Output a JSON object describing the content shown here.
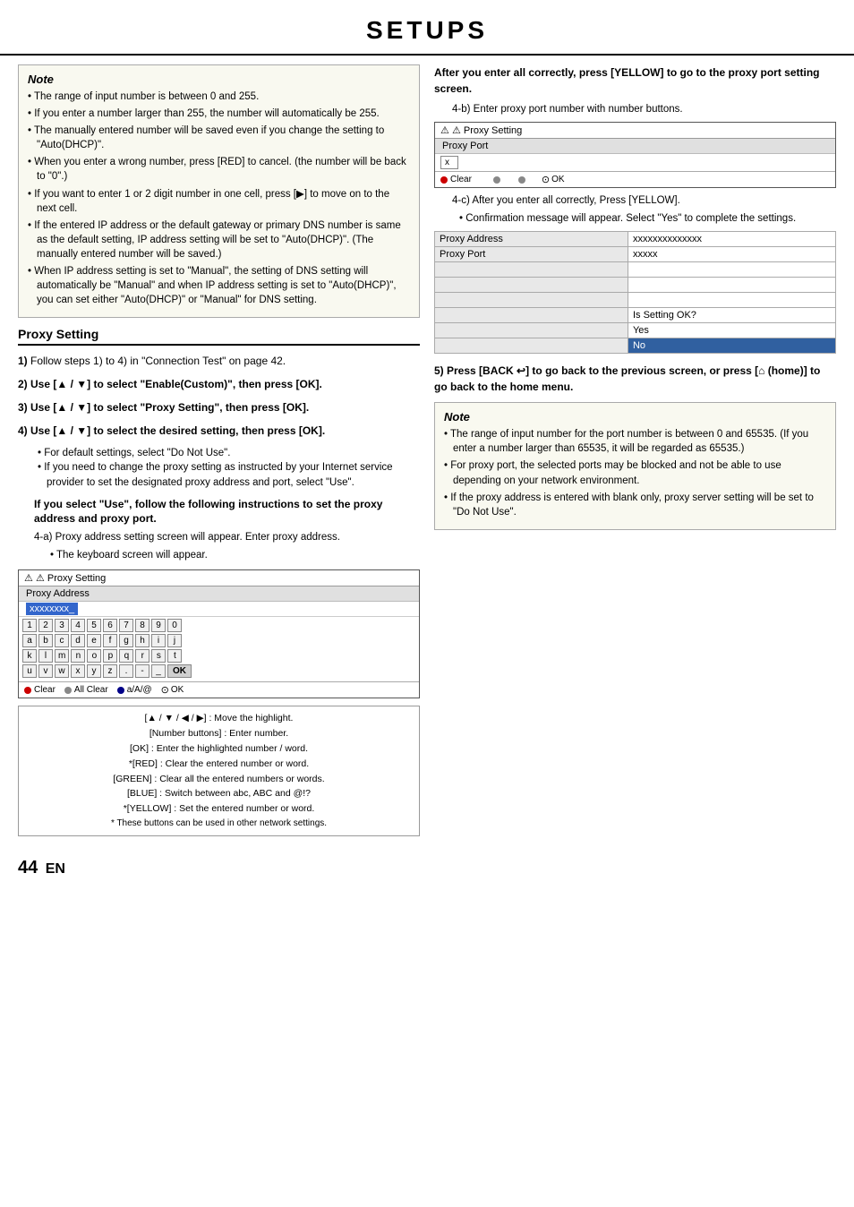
{
  "header": {
    "title": "SETUPS"
  },
  "left": {
    "note": {
      "title": "Note",
      "items": [
        "The range of input number is between 0 and 255.",
        "If you enter a number larger than 255, the number will automatically be 255.",
        "The manually entered number will be saved even if you change the setting to \"Auto(DHCP)\".",
        "When you enter a wrong number, press [RED] to cancel. (the number will be back to \"0\".)",
        "If you want to enter 1 or 2 digit number in one cell, press [▶] to move on to the next cell.",
        "If the entered IP address or the default gateway or primary DNS number is same as the default setting, IP address setting will be set to \"Auto(DHCP)\". (The manually entered number will be saved.)",
        "When IP address setting is set to \"Manual\", the setting of DNS setting will automatically be \"Manual\" and when IP address setting is set to \"Auto(DHCP)\", you can set either \"Auto(DHCP)\" or \"Manual\" for DNS setting."
      ]
    },
    "section_title": "Proxy Setting",
    "steps": [
      {
        "num": "1)",
        "text": "Follow steps 1) to 4) in \"Connection Test\" on page 42."
      },
      {
        "num": "2)",
        "text": "Use [▲ / ▼] to select \"Enable(Custom)\", then press [OK]."
      },
      {
        "num": "3)",
        "text": "Use [▲ / ▼] to select \"Proxy Setting\", then press [OK]."
      },
      {
        "num": "4)",
        "text": "Use [▲ / ▼] to select the desired setting, then press [OK]."
      }
    ],
    "step4_bullets": [
      "For default settings, select \"Do Not Use\".",
      "If you need to change the proxy setting as instructed by your Internet service provider to set the designated proxy address and port, select \"Use\"."
    ],
    "instructions_bold": "If you select \"Use\", follow the following instructions to set the proxy address and proxy port.",
    "step4a_title": "4-a)  Proxy address setting screen will appear. Enter proxy address.",
    "step4a_bullet": "The keyboard screen will appear.",
    "keyboard_screen": {
      "header": "⚠ Proxy Setting",
      "label": "Proxy Address",
      "input_value": "xxxxxxxx_",
      "rows": [
        [
          "1",
          "2",
          "3",
          "4",
          "5",
          "6",
          "7",
          "8",
          "9",
          "0"
        ],
        [
          "a",
          "b",
          "c",
          "d",
          "e",
          "f",
          "g",
          "h",
          "i",
          "j"
        ],
        [
          "k",
          "l",
          "m",
          "n",
          "o",
          "p",
          "q",
          "r",
          "s",
          "t"
        ],
        [
          "u",
          "v",
          "w",
          "x",
          "y",
          "z",
          ".",
          "-",
          "_",
          "OK"
        ]
      ],
      "footer": {
        "clear": "Clear",
        "all_clear": "All Clear",
        "aA": "a/A/@",
        "ok": "OK"
      }
    },
    "legend": {
      "line1": "[▲ / ▼ / ◀ / ▶] : Move the highlight.",
      "line2": "[Number buttons] : Enter number.",
      "line3": "[OK] : Enter the highlighted number / word.",
      "line4": "*[RED] : Clear the entered number or word.",
      "line5": "[GREEN] : Clear all the entered numbers or words.",
      "line6": "[BLUE] : Switch between abc, ABC and @!?",
      "line7": "*[YELLOW] : Set the entered number or word.",
      "line8": "* These buttons can be used in other network settings."
    }
  },
  "right": {
    "after_note": "After you enter all correctly, press [YELLOW] to go to the proxy port setting screen.",
    "step4b": "4-b)  Enter proxy port number with number buttons.",
    "proxy_port_screen": {
      "header": "⚠ Proxy Setting",
      "label": "Proxy Port",
      "input_value": "x",
      "footer": {
        "clear": "Clear",
        "ok": "OK"
      }
    },
    "step4c_title": "4-c)  After you enter all correctly, Press [YELLOW].",
    "step4c_bullet": "Confirmation message will appear. Select \"Yes\" to complete the settings.",
    "confirm_table": {
      "rows": [
        {
          "label": "Proxy Address",
          "value": "xxxxxxxxxxxxxx"
        },
        {
          "label": "Proxy Port",
          "value": "xxxxx"
        },
        {
          "label": "",
          "value": ""
        },
        {
          "label": "",
          "value": ""
        },
        {
          "label": "",
          "value": ""
        },
        {
          "label": "",
          "value": "Is Setting OK?"
        },
        {
          "label": "",
          "value": "Yes"
        },
        {
          "label": "",
          "value": "No"
        }
      ]
    },
    "step5": "5)  Press [BACK ↩] to go back to the previous screen, or press [⌂ (home)] to go back to the home menu.",
    "note2": {
      "title": "Note",
      "items": [
        "The range of input number for the port number is between 0 and 65535.  (If you enter a number larger than 65535, it will be regarded as 65535.)",
        "For proxy port, the selected ports may be blocked and not be able to use depending on  your network environment.",
        "If the proxy address is entered with blank only, proxy server setting will be set to \"Do Not Use\"."
      ]
    }
  },
  "footer": {
    "page": "44",
    "lang": "EN"
  }
}
